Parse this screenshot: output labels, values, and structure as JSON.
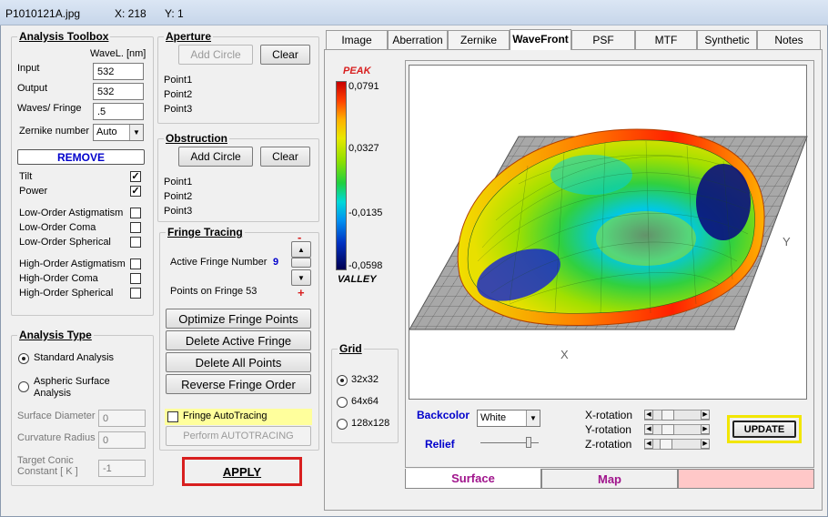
{
  "window": {
    "filename": "P1010121A.jpg",
    "x_readout": "X: 218",
    "y_readout": "Y: 1"
  },
  "analysis_toolbox": {
    "title": "Analysis Toolbox",
    "wavel_label": "WaveL. [nm]",
    "input_label": "Input",
    "input_value": "532",
    "output_label": "Output",
    "output_value": "532",
    "waves_fringe_label": "Waves/ Fringe",
    "waves_fringe_value": ".5",
    "zernike_label": "Zernike number",
    "zernike_value": "Auto",
    "remove_label": "REMOVE",
    "terms": [
      {
        "label": "Tilt",
        "checked": true
      },
      {
        "label": "Power",
        "checked": true
      },
      {
        "label": "Low-Order  Astigmatism",
        "checked": false
      },
      {
        "label": "Low-Order  Coma",
        "checked": false
      },
      {
        "label": "Low-Order  Spherical",
        "checked": false
      },
      {
        "label": "High-Order  Astigmatism",
        "checked": false
      },
      {
        "label": "High-Order  Coma",
        "checked": false
      },
      {
        "label": "High-Order  Spherical",
        "checked": false
      }
    ]
  },
  "analysis_type": {
    "title": "Analysis Type",
    "standard_label": "Standard Analysis",
    "aspheric_label1": "Aspheric  Surface",
    "aspheric_label2": "Analysis",
    "surface_diameter_label": "Surface Diameter",
    "surface_diameter_value": "0",
    "curvature_radius_label": "Curvature Radius",
    "curvature_radius_value": "0",
    "conic_label1": "Target Conic",
    "conic_label2": "Constant [ K ]",
    "conic_value": "-1"
  },
  "apply_label": "APPLY",
  "aperture": {
    "title": "Aperture",
    "add_circle_label": "Add Circle",
    "clear_label": "Clear",
    "points": [
      "Point1",
      "Point2",
      "Point3"
    ]
  },
  "obstruction": {
    "title": "Obstruction",
    "add_circle_label": "Add Circle",
    "clear_label": "Clear",
    "points": [
      "Point1",
      "Point2",
      "Point3"
    ]
  },
  "fringe_tracing": {
    "title": "Fringe Tracing",
    "active_fringe_label": "Active Fringe Number",
    "active_fringe_value": "9",
    "points_on_fringe_label": "Points on  Fringe 53",
    "minus": "-",
    "plus": "+",
    "optimize_label": "Optimize Fringe Points",
    "delete_active_label": "Delete Active Fringe",
    "delete_all_label": "Delete  All  Points",
    "reverse_label": "Reverse  Fringe Order",
    "autotracing_label": "Fringe AutoTracing",
    "perform_label": "Perform  AUTOTRACING"
  },
  "tabs": [
    "Image",
    "Aberration",
    "Zernike",
    "WaveFront",
    "PSF",
    "MTF",
    "Synthetic",
    "Notes"
  ],
  "active_tab": "WaveFront",
  "colorbar": {
    "peak_label": "PEAK",
    "valley_label": "VALLEY",
    "ticks": [
      "0,0791",
      "0,0327",
      "-0,0135",
      "-0,0598"
    ]
  },
  "grid": {
    "title": "Grid",
    "options": [
      "32x32",
      "64x64",
      "128x128"
    ],
    "selected": "32x32"
  },
  "plot": {
    "x_axis_label": "X",
    "y_axis_label": "Y"
  },
  "controls": {
    "backcolor_label": "Backcolor",
    "backcolor_value": "White",
    "relief_label": "Relief",
    "x_rotation_label": "X-rotation",
    "y_rotation_label": "Y-rotation",
    "z_rotation_label": "Z-rotation",
    "update_label": "UPDATE"
  },
  "view_tabs": {
    "surface_label": "Surface",
    "map_label": "Map"
  },
  "colors": {
    "accent_blue": "#0000cc",
    "apply_border": "#d81f1f",
    "update_border": "#f2e600",
    "view_tab_text": "#a0148c"
  }
}
